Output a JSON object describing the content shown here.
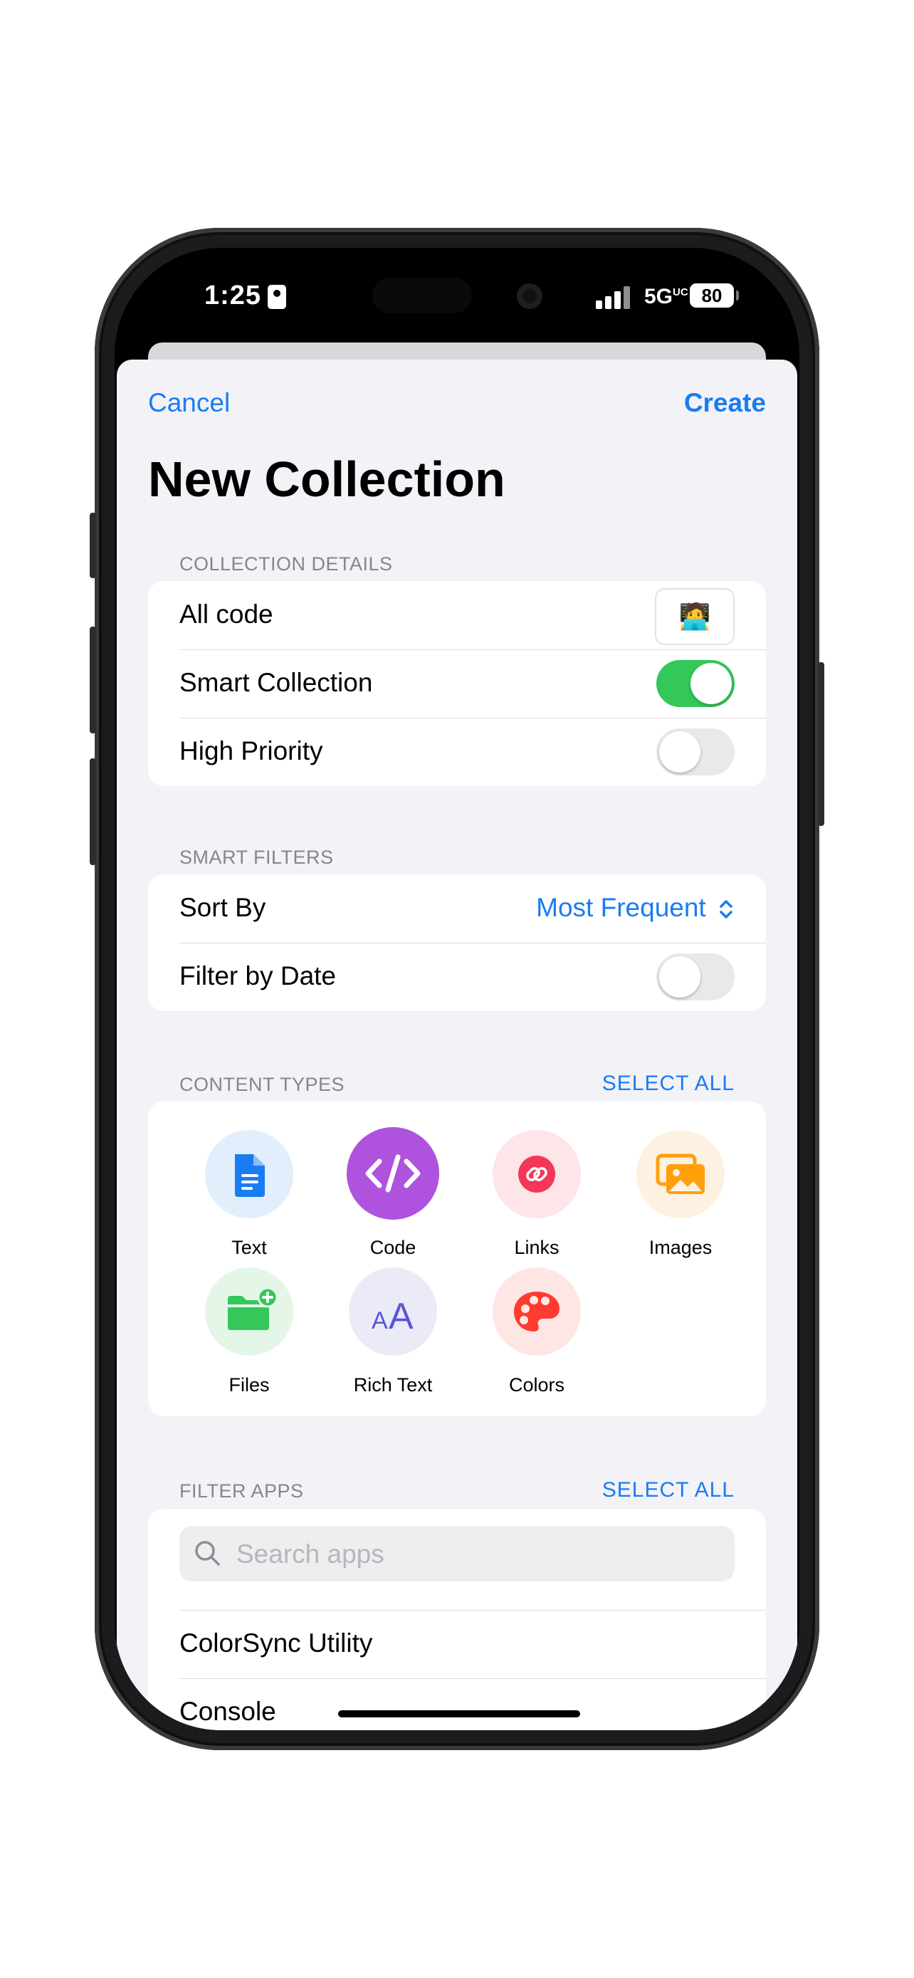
{
  "status_bar": {
    "time": "1:25",
    "network": "5G",
    "network_suffix": "UC",
    "battery": "80"
  },
  "nav": {
    "cancel": "Cancel",
    "create": "Create"
  },
  "title": "New Collection",
  "collection_details": {
    "header": "COLLECTION DETAILS",
    "name": "All code",
    "emoji": "🧑‍💻",
    "smart_collection_label": "Smart Collection",
    "smart_collection_on": true,
    "high_priority_label": "High Priority",
    "high_priority_on": false
  },
  "smart_filters": {
    "header": "SMART FILTERS",
    "sort_by_label": "Sort By",
    "sort_by_value": "Most Frequent",
    "filter_by_date_label": "Filter by Date",
    "filter_by_date_on": false
  },
  "content_types": {
    "header": "CONTENT TYPES",
    "select_all": "SELECT ALL",
    "items": [
      {
        "label": "Text",
        "icon": "document-icon",
        "selected": false
      },
      {
        "label": "Code",
        "icon": "code-icon",
        "selected": true
      },
      {
        "label": "Links",
        "icon": "link-icon",
        "selected": false
      },
      {
        "label": "Images",
        "icon": "images-icon",
        "selected": false
      },
      {
        "label": "Files",
        "icon": "folder-add-icon",
        "selected": false
      },
      {
        "label": "Rich Text",
        "icon": "rich-text-icon",
        "selected": false
      },
      {
        "label": "Colors",
        "icon": "palette-icon",
        "selected": false
      }
    ]
  },
  "filter_apps": {
    "header": "FILTER APPS",
    "select_all": "SELECT ALL",
    "search_placeholder": "Search apps",
    "apps": [
      "ColorSync Utility",
      "Console"
    ]
  },
  "colors": {
    "accent": "#1a7cf2",
    "toggle_on": "#34c759",
    "code_selected": "#af52de"
  }
}
